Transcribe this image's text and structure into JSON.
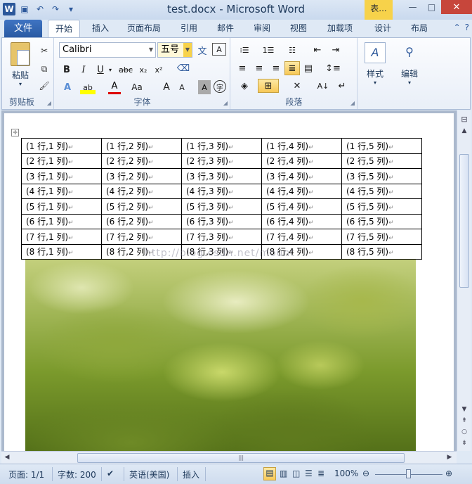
{
  "window": {
    "title": "test.docx - Microsoft Word",
    "context_tab": "表..."
  },
  "tabs": {
    "file": "文件",
    "items": [
      "开始",
      "插入",
      "页面布局",
      "引用",
      "邮件",
      "审阅",
      "视图",
      "加载项",
      "设计",
      "布局"
    ]
  },
  "ribbon": {
    "clipboard": {
      "paste": "粘贴",
      "label": "剪贴板"
    },
    "font": {
      "family": "Calibri",
      "size": "五号",
      "label": "字体",
      "bold": "B",
      "italic": "I",
      "underline": "U",
      "strike": "abc",
      "sub": "x₂",
      "sup": "x²",
      "grow": "A",
      "shrink": "A",
      "case": "Aa"
    },
    "paragraph": {
      "label": "段落"
    },
    "styles": {
      "label": "样式"
    },
    "editing": {
      "label": "编辑"
    }
  },
  "document": {
    "table": [
      [
        "(1 行,1 列)",
        "(1 行,2 列)",
        "(1 行,3 列)",
        "(1 行,4 列)",
        "(1 行,5 列)"
      ],
      [
        "(2 行,1 列)",
        "(2 行,2 列)",
        "(2 行,3 列)",
        "(2 行,4 列)",
        "(2 行,5 列)"
      ],
      [
        "(3 行,1 列)",
        "(3 行,2 列)",
        "(3 行,3 列)",
        "(3 行,4 列)",
        "(3 行,5 列)"
      ],
      [
        "(4 行,1 列)",
        "(4 行,2 列)",
        "(4 行,3 列)",
        "(4 行,4 列)",
        "(4 行,5 列)"
      ],
      [
        "(5 行,1 列)",
        "(5 行,2 列)",
        "(5 行,3 列)",
        "(5 行,4 列)",
        "(5 行,5 列)"
      ],
      [
        "(6 行,1 列)",
        "(6 行,2 列)",
        "(6 行,3 列)",
        "(6 行,4 列)",
        "(6 行,5 列)"
      ],
      [
        "(7 行,1 列)",
        "(7 行,2 列)",
        "(7 行,3 列)",
        "(7 行,4 列)",
        "(7 行,5 列)"
      ],
      [
        "(8 行,1 列)",
        "(8 行,2 列)",
        "(8 行,3 列)",
        "(8 行,4 列)",
        "(8 行,5 列)"
      ]
    ],
    "watermark": "http://blog.csdn.net/mount"
  },
  "status": {
    "page": "页面: 1/1",
    "words": "字数: 200",
    "language": "英语(美国)",
    "mode": "插入",
    "zoom": "100%"
  },
  "colors": {
    "accent": "#2b579a",
    "file_tab": "#2a5aa3",
    "close": "#c7463b",
    "context": "#f7d24a"
  }
}
